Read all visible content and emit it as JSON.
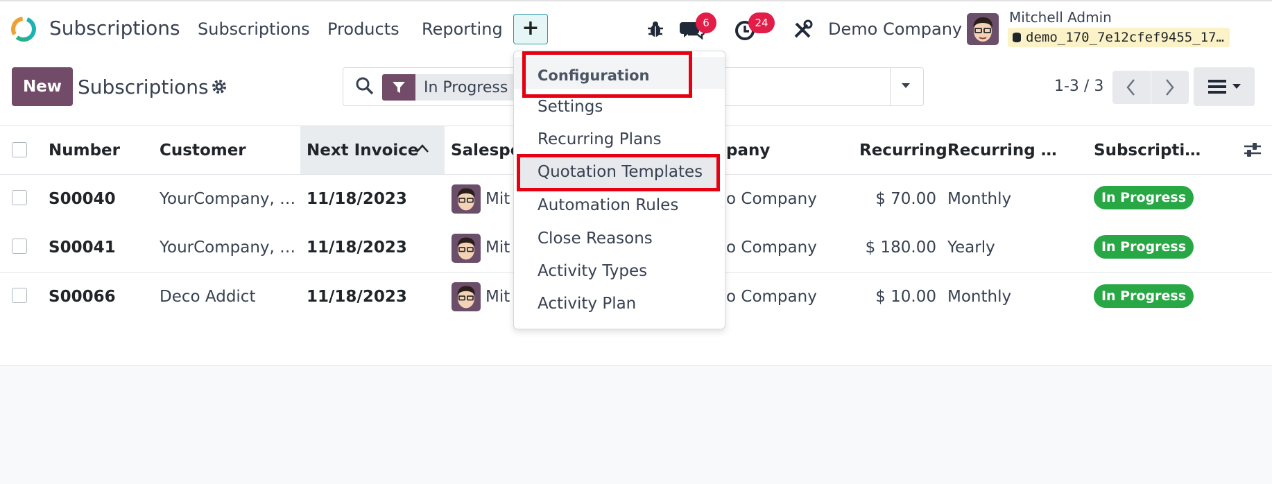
{
  "navbar": {
    "app_title": "Subscriptions",
    "menu": [
      "Subscriptions",
      "Products",
      "Reporting"
    ],
    "plus_label": "+",
    "messages_count": "6",
    "activities_count": "24",
    "company": "Demo Company",
    "user_name": "Mitchell Admin",
    "database": "demo_170_7e12cfef9455_17…"
  },
  "control": {
    "new_label": "New",
    "page_title": "Subscriptions",
    "facet_label": "In Progress",
    "pager": "1-3 / 3"
  },
  "table": {
    "headers": {
      "number": "Number",
      "customer": "Customer",
      "next_invoice": "Next Invoice",
      "salesperson": "Salespe",
      "company": "pany",
      "recurring": "Recurring",
      "recurring_plan": "Recurring …",
      "subscription_status": "Subscripti…"
    },
    "rows": [
      {
        "number": "S00040",
        "customer": "YourCompany, …",
        "next_invoice": "11/18/2023",
        "salesperson": "Mit",
        "company": "o Company",
        "recurring": "$ 70.00",
        "plan": "Monthly",
        "status": "In Progress"
      },
      {
        "number": "S00041",
        "customer": "YourCompany, …",
        "next_invoice": "11/18/2023",
        "salesperson": "Mit",
        "company": "o Company",
        "recurring": "$ 180.00",
        "plan": "Yearly",
        "status": "In Progress"
      },
      {
        "number": "S00066",
        "customer": "Deco Addict",
        "next_invoice": "11/18/2023",
        "salesperson": "Mit",
        "company": "o Company",
        "recurring": "$ 10.00",
        "plan": "Monthly",
        "status": "In Progress"
      }
    ]
  },
  "dropdown": {
    "header": "Configuration",
    "items": [
      "Settings",
      "Recurring Plans",
      "Quotation Templates",
      "Automation Rules",
      "Close Reasons",
      "Activity Types",
      "Activity Plan"
    ]
  },
  "colors": {
    "brand": "#714b67",
    "status_green": "#28a745",
    "badge_red": "#e11d48",
    "highlight_red": "#e60012"
  }
}
